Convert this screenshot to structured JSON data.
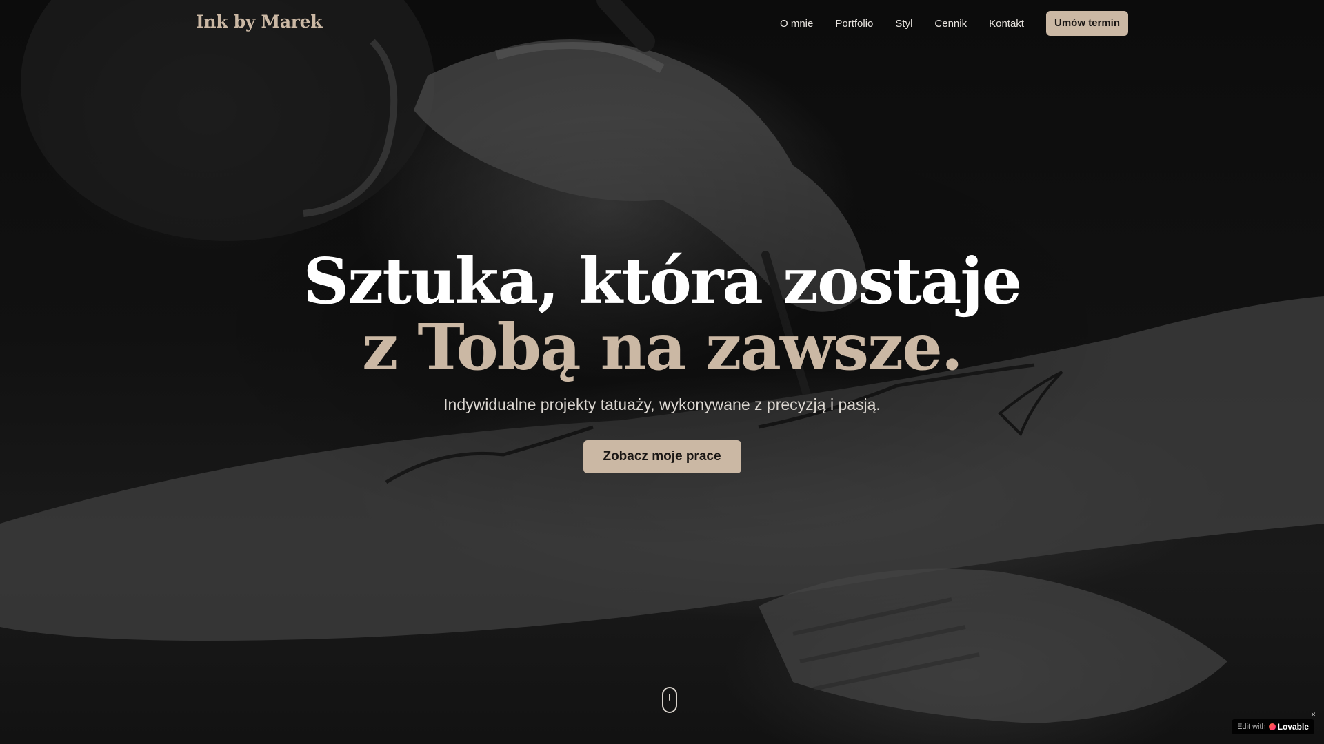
{
  "brand": "Ink by Marek",
  "nav": {
    "items": [
      {
        "label": "O mnie"
      },
      {
        "label": "Portfolio"
      },
      {
        "label": "Styl"
      },
      {
        "label": "Cennik"
      },
      {
        "label": "Kontakt"
      }
    ],
    "cta_label": "Umów termin"
  },
  "hero": {
    "headline_line1": "Sztuka, która zostaje",
    "headline_line2": "z Tobą na zawsze.",
    "subtitle": "Indywidualne projekty tatuaży, wykonywane z precyzją i pasją.",
    "cta_label": "Zobacz moje prace"
  },
  "badge": {
    "prefix": "Edit with",
    "brand": "Lovable",
    "close": "×"
  },
  "colors": {
    "accent": "#cbb8a4",
    "background": "#0b0b0b",
    "text": "#ffffff"
  },
  "icons": {
    "scroll": "mouse-scroll-icon",
    "badge_logo": "lovable-heart-icon"
  }
}
